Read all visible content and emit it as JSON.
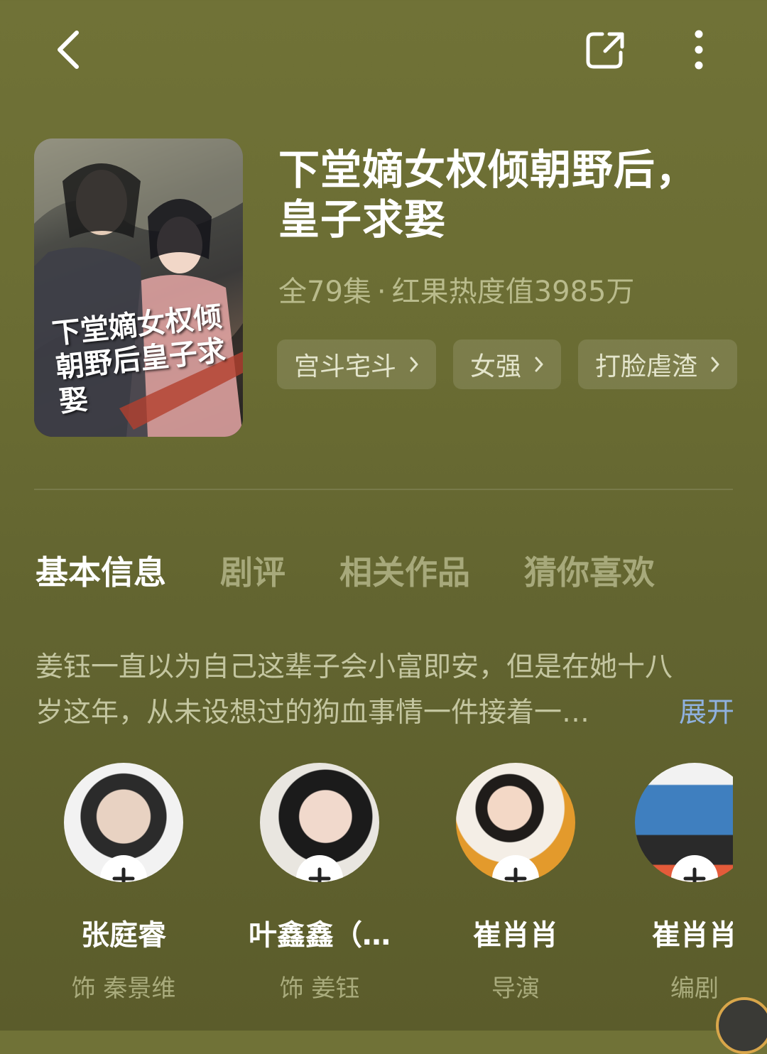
{
  "header": {
    "back_icon": "chevron-left-icon",
    "share_icon": "share-icon",
    "more_icon": "more-vertical-icon"
  },
  "drama": {
    "poster_title": "下堂嫡女权倾朝野后皇子求娶",
    "title": "下堂嫡女权倾朝野后，皇子求娶",
    "episodes": "全79集",
    "separator": "·",
    "heat": "红果热度值3985万",
    "tags": [
      {
        "label": "宫斗宅斗"
      },
      {
        "label": "女强"
      },
      {
        "label": "打脸虐渣"
      }
    ]
  },
  "tabs": [
    {
      "label": "基本信息",
      "active": true
    },
    {
      "label": "剧评",
      "active": false
    },
    {
      "label": "相关作品",
      "active": false
    },
    {
      "label": "猜你喜欢",
      "active": false
    }
  ],
  "description": {
    "line1": "姜钰一直以为自己这辈子会小富即安，但是在她十八",
    "line2": "岁这年，从未设想过的狗血事情一件接着一…",
    "expand_label": "展开"
  },
  "cast": [
    {
      "name": "张庭睿",
      "role": "饰 秦景维"
    },
    {
      "name": "叶鑫鑫（…",
      "role": "饰 姜钰"
    },
    {
      "name": "崔肖肖",
      "role": "导演"
    },
    {
      "name": "崔肖肖",
      "role": "编剧"
    }
  ],
  "colors": {
    "background": "#6a6c33",
    "link": "#8fb1df",
    "muted_text": "#b9bb8c"
  }
}
